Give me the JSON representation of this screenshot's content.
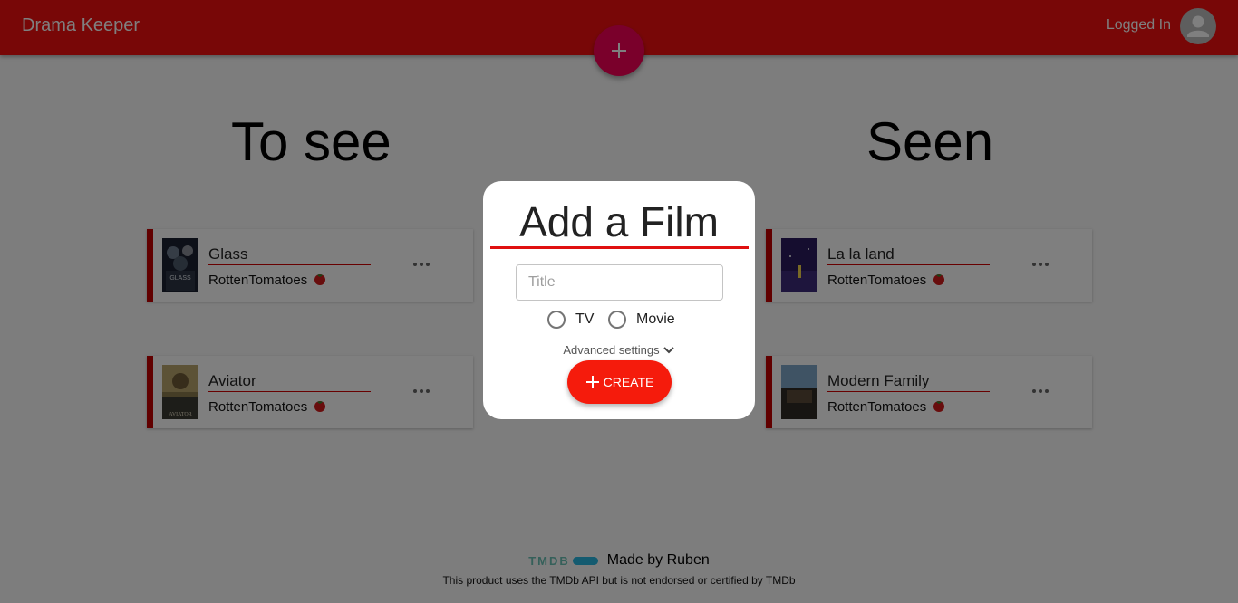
{
  "app": {
    "title": "Drama Keeper",
    "status": "Logged In",
    "accent_color": "#f10f0f",
    "fab_color": "#f50057",
    "avatar_icon": "account-circle-icon",
    "add_icon": "plus-icon"
  },
  "columns": {
    "to_see": {
      "heading": "To see",
      "cards": [
        {
          "title": "Glass",
          "source": "RottenTomatoes",
          "source_icon": "tomato-icon",
          "menu_icon": "more-horizontal-icon"
        },
        {
          "title": "Aviator",
          "source": "RottenTomatoes",
          "source_icon": "tomato-icon",
          "menu_icon": "more-horizontal-icon"
        }
      ]
    },
    "seen": {
      "heading": "Seen",
      "cards": [
        {
          "title": "La la land",
          "source": "RottenTomatoes",
          "source_icon": "tomato-icon",
          "menu_icon": "more-horizontal-icon"
        },
        {
          "title": "Modern Family",
          "source": "RottenTomatoes",
          "source_icon": "tomato-icon",
          "menu_icon": "more-horizontal-icon"
        }
      ]
    }
  },
  "modal": {
    "title": "Add a Film",
    "title_input": {
      "placeholder": "Title",
      "value": ""
    },
    "type_options": [
      "TV",
      "Movie"
    ],
    "selected_type": null,
    "advanced_label": "Advanced settings",
    "create_label": "CREATE",
    "create_color": "#f51b0c"
  },
  "footer": {
    "logo_text": "TMDB",
    "made_by": "Made by Ruben",
    "disclaimer": "This product uses the TMDb API but is not endorsed or certified by TMDb"
  }
}
